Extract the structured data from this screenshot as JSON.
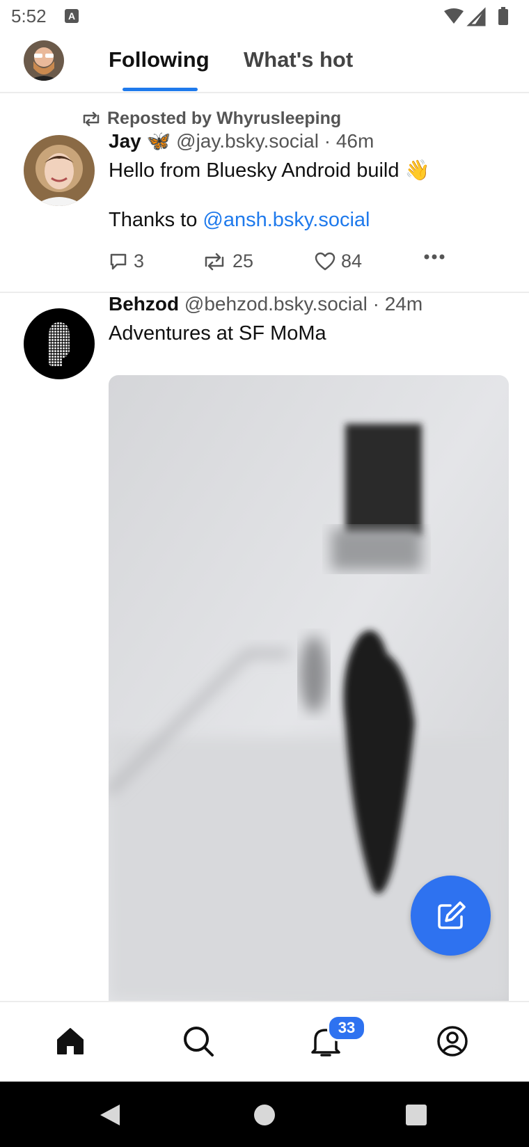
{
  "status": {
    "time": "5:52",
    "notif_letter": "A"
  },
  "header": {
    "tabs": [
      {
        "label": "Following",
        "active": true
      },
      {
        "label": "What's hot",
        "active": false
      }
    ],
    "accent": "#1f7aec"
  },
  "feed": {
    "posts": [
      {
        "repost_label": "Reposted by Whyrusleeping",
        "author_name": "Jay",
        "author_emoji": "🦋",
        "handle": "@jay.bsky.social",
        "time": "· 46m",
        "text_line1": "Hello from Bluesky Android build 👋",
        "text_line2_prefix": "Thanks to ",
        "mention": "@ansh.bsky.social",
        "replies": "3",
        "reposts": "25",
        "likes": "84"
      },
      {
        "author_name": "Behzod",
        "handle": "@behzod.bsky.social",
        "time": "· 24m",
        "text": "Adventures at SF MoMa"
      }
    ]
  },
  "bottom_nav": {
    "notifications_badge": "33"
  },
  "colors": {
    "accent": "#1f7aec",
    "fab": "#2e72f0"
  }
}
